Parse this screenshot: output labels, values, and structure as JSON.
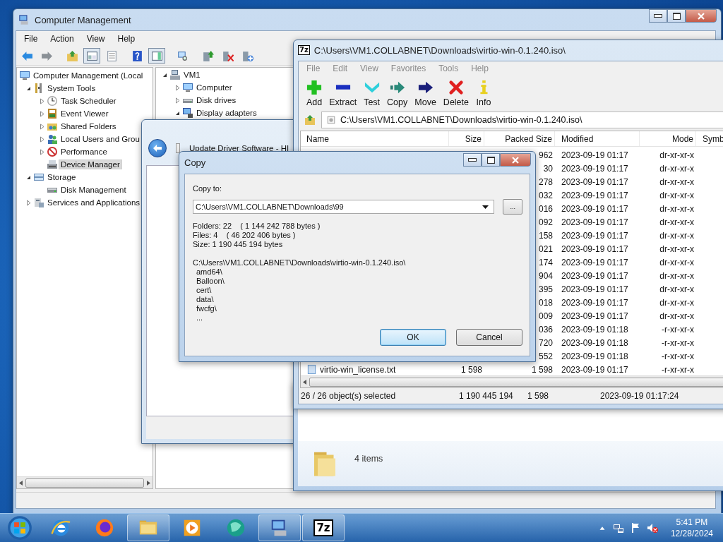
{
  "computer_management": {
    "title": "Computer Management",
    "menu": [
      {
        "label": "File"
      },
      {
        "label": "Action"
      },
      {
        "label": "View"
      },
      {
        "label": "Help"
      }
    ],
    "toolbar": [
      {
        "kind": "back",
        "pressed": false
      },
      {
        "kind": "forward",
        "pressed": false
      },
      {
        "kind": "folderup",
        "pressed": false
      },
      {
        "kind": "tree",
        "pressed": true
      },
      {
        "kind": "list",
        "pressed": false
      },
      {
        "kind": "help",
        "pressed": false
      },
      {
        "kind": "panel",
        "pressed": true
      },
      {
        "kind": "scan",
        "pressed": false
      },
      {
        "kind": "update",
        "pressed": false
      },
      {
        "kind": "remove",
        "pressed": false
      },
      {
        "kind": "addhw",
        "pressed": false
      }
    ],
    "tree": [
      {
        "label": "Computer Management (Local",
        "kind": "computer",
        "expandable": false,
        "selected": false,
        "children": [
          {
            "label": "System Tools",
            "kind": "tools",
            "expandable": true,
            "expanded": true,
            "selected": false,
            "children": [
              {
                "label": "Task Scheduler",
                "kind": "clock",
                "expandable": true,
                "expanded": false,
                "selected": false
              },
              {
                "label": "Event Viewer",
                "kind": "viewer",
                "expandable": true,
                "expanded": false,
                "selected": false
              },
              {
                "label": "Shared Folders",
                "kind": "share",
                "expandable": true,
                "expanded": false,
                "selected": false
              },
              {
                "label": "Local Users and Grou",
                "kind": "users",
                "expandable": true,
                "expanded": false,
                "selected": false
              },
              {
                "label": "Performance",
                "kind": "performance",
                "expandable": true,
                "expanded": false,
                "selected": false
              },
              {
                "label": "Device Manager",
                "kind": "device",
                "expandable": false,
                "selected": true
              }
            ]
          },
          {
            "label": "Storage",
            "kind": "storage",
            "expandable": true,
            "expanded": true,
            "selected": false,
            "children": [
              {
                "label": "Disk Management",
                "kind": "disk",
                "expandable": false,
                "selected": false
              }
            ]
          },
          {
            "label": "Services and Applications",
            "kind": "services",
            "expandable": true,
            "expanded": false,
            "selected": false
          }
        ]
      }
    ],
    "device_tree": [
      {
        "label": "VM1",
        "kind": "host",
        "expandable": true,
        "expanded": true,
        "selected": false,
        "children": [
          {
            "label": "Computer",
            "kind": "monitor",
            "expandable": true,
            "expanded": false,
            "selected": false
          },
          {
            "label": "Disk drives",
            "kind": "drive",
            "expandable": true,
            "expanded": false,
            "selected": false
          },
          {
            "label": "Display adapters",
            "kind": "display",
            "expandable": true,
            "expanded": true,
            "selected": false
          }
        ]
      }
    ]
  },
  "update_driver": {
    "title": "Update Driver Software - HI"
  },
  "sevenzip": {
    "logo": "7z",
    "title": "C:\\Users\\VM1.COLLABNET\\Downloads\\virtio-win-0.1.240.iso\\",
    "menu": [
      {
        "label": "File"
      },
      {
        "label": "Edit"
      },
      {
        "label": "View"
      },
      {
        "label": "Favorites"
      },
      {
        "label": "Tools"
      },
      {
        "label": "Help"
      }
    ],
    "toolbar": [
      {
        "label": "Add",
        "kind": "add"
      },
      {
        "label": "Extract",
        "kind": "extract"
      },
      {
        "label": "Test",
        "kind": "test"
      },
      {
        "label": "Copy",
        "kind": "copy"
      },
      {
        "label": "Move",
        "kind": "move"
      },
      {
        "label": "Delete",
        "kind": "delete"
      },
      {
        "label": "Info",
        "kind": "info"
      }
    ],
    "address": "C:\\Users\\VM1.COLLABNET\\Downloads\\virtio-win-0.1.240.iso\\",
    "columns": [
      "Name",
      "Size",
      "Packed Size",
      "Modified",
      "Mode",
      "Symb"
    ],
    "rows": [
      {
        "packed": "962",
        "modified": "2023-09-19 01:17",
        "mode": "dr-xr-xr-x"
      },
      {
        "packed": "30",
        "modified": "2023-09-19 01:17",
        "mode": "dr-xr-xr-x"
      },
      {
        "packed": "278",
        "modified": "2023-09-19 01:17",
        "mode": "dr-xr-xr-x"
      },
      {
        "packed": "032",
        "modified": "2023-09-19 01:17",
        "mode": "dr-xr-xr-x"
      },
      {
        "packed": "016",
        "modified": "2023-09-19 01:17",
        "mode": "dr-xr-xr-x"
      },
      {
        "packed": "092",
        "modified": "2023-09-19 01:17",
        "mode": "dr-xr-xr-x"
      },
      {
        "packed": "158",
        "modified": "2023-09-19 01:17",
        "mode": "dr-xr-xr-x"
      },
      {
        "packed": "021",
        "modified": "2023-09-19 01:17",
        "mode": "dr-xr-xr-x"
      },
      {
        "packed": "174",
        "modified": "2023-09-19 01:17",
        "mode": "dr-xr-xr-x"
      },
      {
        "packed": "904",
        "modified": "2023-09-19 01:17",
        "mode": "dr-xr-xr-x"
      },
      {
        "packed": "395",
        "modified": "2023-09-19 01:17",
        "mode": "dr-xr-xr-x"
      },
      {
        "packed": "018",
        "modified": "2023-09-19 01:17",
        "mode": "dr-xr-xr-x"
      },
      {
        "packed": "009",
        "modified": "2023-09-19 01:17",
        "mode": "dr-xr-xr-x"
      },
      {
        "packed": "036",
        "modified": "2023-09-19 01:18",
        "mode": "-r-xr-xr-x"
      },
      {
        "packed": "720",
        "modified": "2023-09-19 01:18",
        "mode": "-r-xr-xr-x"
      },
      {
        "packed": "552",
        "modified": "2023-09-19 01:18",
        "mode": "-r-xr-xr-x"
      },
      {
        "name": "virtio-win_license.txt",
        "size": "1 598",
        "packed": "1 598",
        "modified": "2023-09-19 01:17",
        "mode": "-r-xr-xr-x"
      }
    ],
    "status": [
      "26 / 26 object(s) selected",
      "1 190 445 194",
      "1 598",
      "2023-09-19 01:17:24"
    ]
  },
  "explorer": {
    "item_count": "4 items"
  },
  "copy_dialog": {
    "title": "Copy",
    "copy_to_label": "Copy to:",
    "destination": "C:\\Users\\VM1.COLLABNET\\Downloads\\99",
    "browse": "...",
    "info": [
      "Folders: 22    ( 1 144 242 788 bytes )",
      "Files: 4    ( 46 202 406 bytes )",
      "Size: 1 190 445 194 bytes"
    ],
    "source": "C:\\Users\\VM1.COLLABNET\\Downloads\\virtio-win-0.1.240.iso\\",
    "items": [
      "amd64\\",
      "Balloon\\",
      "cert\\",
      "data\\",
      "fwcfg\\",
      "..."
    ],
    "buttons": [
      {
        "label": "OK",
        "default": true
      },
      {
        "label": "Cancel",
        "default": false
      }
    ]
  },
  "taskbar": {
    "apps": [
      {
        "kind": "ie",
        "open": false
      },
      {
        "kind": "firefox",
        "open": false
      },
      {
        "kind": "explorer",
        "open": true
      },
      {
        "kind": "player",
        "open": false
      },
      {
        "kind": "orb",
        "open": false
      },
      {
        "kind": "management",
        "open": true
      },
      {
        "kind": "sevenzip",
        "open": true,
        "label": "7z"
      }
    ],
    "time": "5:41 PM",
    "date": "12/28/2024"
  }
}
